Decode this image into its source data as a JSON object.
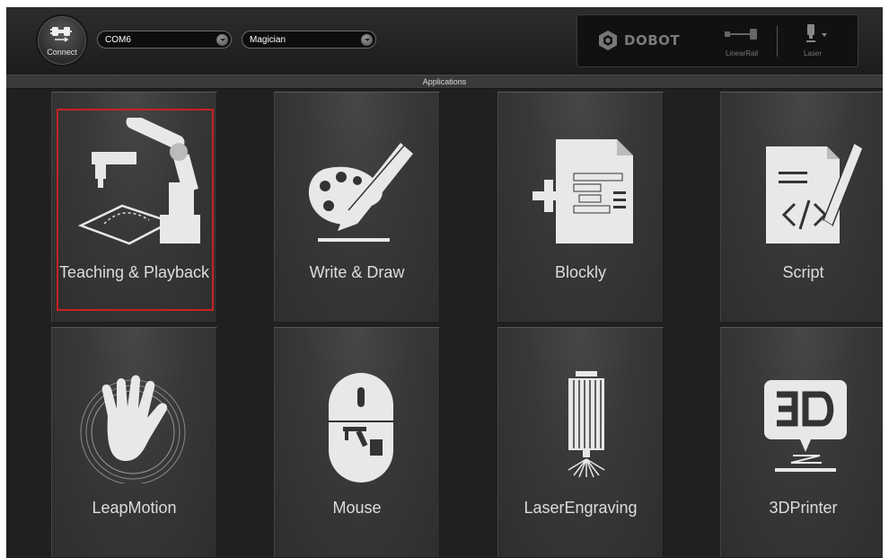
{
  "toolbar": {
    "connect_label": "Connect",
    "port_value": "COM6",
    "device_value": "Magician",
    "brand": "DOBOT",
    "accessory_rail_label": "LinearRail",
    "accessory_tool_label": "Laser"
  },
  "section_label": "Applications",
  "apps": [
    {
      "label": "Teaching & Playback",
      "icon": "robot-arm-icon",
      "selected": true
    },
    {
      "label": "Write & Draw",
      "icon": "palette-pencil-icon",
      "selected": false
    },
    {
      "label": "Blockly",
      "icon": "blockly-document-icon",
      "selected": false
    },
    {
      "label": "Script",
      "icon": "script-document-icon",
      "selected": false
    },
    {
      "label": "LeapMotion",
      "icon": "hand-icon",
      "selected": false
    },
    {
      "label": "Mouse",
      "icon": "mouse-icon",
      "selected": false
    },
    {
      "label": "LaserEngraving",
      "icon": "laser-engraver-icon",
      "selected": false
    },
    {
      "label": "3DPrinter",
      "icon": "3d-printer-icon",
      "selected": false
    }
  ],
  "colors": {
    "selection": "#c82121",
    "background": "#202020",
    "text": "#dddddd"
  }
}
